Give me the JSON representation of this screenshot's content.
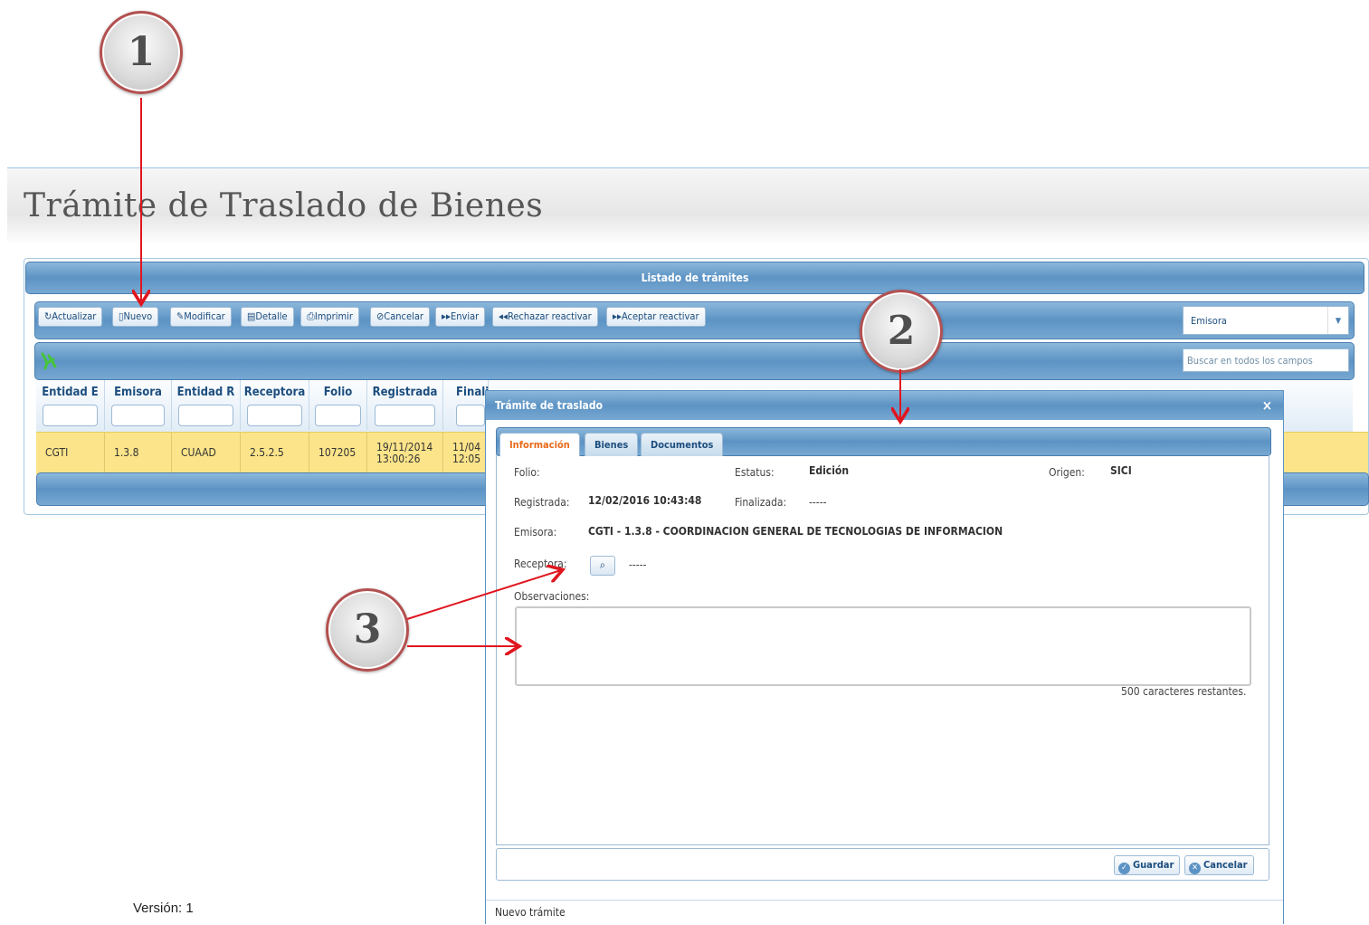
{
  "page": {
    "title": "Trámite de Traslado de Bienes",
    "version": "Versión: 1"
  },
  "grid": {
    "caption": "Listado de trámites",
    "toolbar": [
      {
        "label": "Actualizar",
        "icon": "refresh-icon"
      },
      {
        "label": "Nuevo",
        "icon": "document-icon"
      },
      {
        "label": "Modificar",
        "icon": "pencil-icon"
      },
      {
        "label": "Detalle",
        "icon": "clipboard-icon"
      },
      {
        "label": "Imprimir",
        "icon": "printer-icon"
      },
      {
        "label": "Cancelar",
        "icon": "cancel-icon"
      },
      {
        "label": "Enviar",
        "icon": "forward-icon"
      },
      {
        "label": "Rechazar reactivar",
        "icon": "rewind-icon"
      },
      {
        "label": "Aceptar reactivar",
        "icon": "forward-icon"
      }
    ],
    "filter_select": "Emisora",
    "search_placeholder": "Buscar en todos los campos",
    "columns": [
      "Entidad E",
      "Emisora",
      "Entidad R",
      "Receptora",
      "Folio",
      "Registrada",
      "Finali"
    ],
    "row": {
      "entidad_e": "CGTI",
      "emisora": "1.3.8",
      "entidad_r": "CUAAD",
      "receptora": "2.5.2.5",
      "folio": "107205",
      "registrada_date": "19/11/2014",
      "registrada_time": "13:00:26",
      "finalizada_date": "11/04",
      "finalizada_time": "12:05"
    }
  },
  "dialog": {
    "title": "Trámite de traslado",
    "close": "×",
    "tabs": [
      "Información",
      "Bienes",
      "Documentos"
    ],
    "fields": {
      "folio_label": "Folio:",
      "estatus_label": "Estatus:",
      "estatus_value": "Edición",
      "origen_label": "Origen:",
      "origen_value": "SICI",
      "registrada_label": "Registrada:",
      "registrada_value": "12/02/2016 10:43:48",
      "finalizada_label": "Finalizada:",
      "finalizada_value": "-----",
      "emisora_label": "Emisora:",
      "emisora_value": "CGTI - 1.3.8 - COORDINACION GENERAL DE TECNOLOGIAS DE INFORMACION",
      "receptora_label": "Receptora:",
      "receptora_value": "-----",
      "observaciones_label": "Observaciones:",
      "remaining": "500 caracteres restantes."
    },
    "buttons": {
      "guardar": "Guardar",
      "cancelar": "Cancelar"
    },
    "status": "Nuevo trámite"
  },
  "callouts": [
    "1",
    "2",
    "3"
  ],
  "colors": {
    "callout_arrow": "#e0161f",
    "grid_blue": "#5c93c4",
    "selected_row": "#fbe48a",
    "active_tab": "#e86a1a"
  }
}
